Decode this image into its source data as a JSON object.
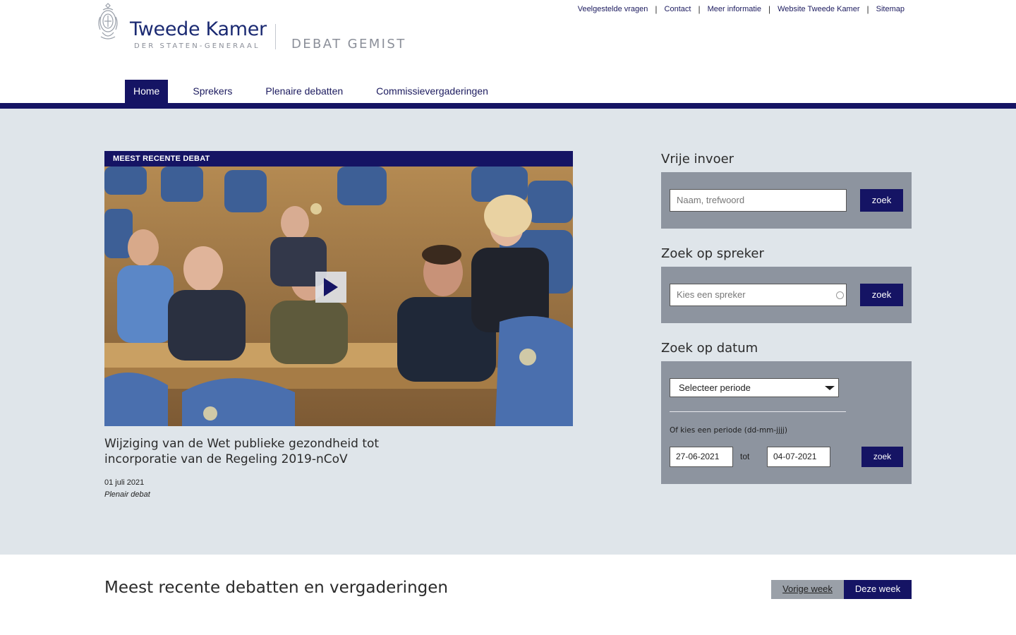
{
  "header": {
    "logo_name": "Tweede Kamer",
    "logo_sub": "DER STATEN-GENERAAL",
    "app_name": "DEBAT GEMIST",
    "top_links": [
      "Veelgestelde vragen",
      "Contact",
      "Meer informatie",
      "Website Tweede Kamer",
      "Sitemap"
    ],
    "top_link_separator": "|"
  },
  "nav": {
    "items": [
      "Home",
      "Sprekers",
      "Plenaire debatten",
      "Commissievergaderingen"
    ],
    "active": "Home"
  },
  "feature": {
    "label": "MEEST RECENTE DEBAT",
    "title": "Wijziging van de Wet publieke gezondheid tot incorporatie van de Regeling 2019-nCoV",
    "date": "01 juli 2021",
    "type": "Plenair debat"
  },
  "search": {
    "free": {
      "heading": "Vrije invoer",
      "placeholder": "Naam, trefwoord",
      "button": "zoek"
    },
    "speaker": {
      "heading": "Zoek op spreker",
      "placeholder": "Kies een spreker",
      "button": "zoek"
    },
    "date": {
      "heading": "Zoek op datum",
      "select_value": "Selecteer periode",
      "hint": "Of kies een periode (dd-mm-jjjj)",
      "from": "27-06-2021",
      "between": "tot",
      "to": "04-07-2021",
      "button": "zoek"
    }
  },
  "recent": {
    "heading": "Meest recente debatten en vergaderingen",
    "tabs": [
      "Vorige week",
      "Deze week"
    ],
    "active_tab": "Deze week"
  },
  "colors": {
    "brand_navy": "#151464",
    "hero_bg": "#dfe5ea",
    "panel_bg": "#8d949f"
  },
  "icons": {
    "crest": "royal-crest-icon",
    "play": "play-icon",
    "select_arrow": "chevron-down-icon"
  }
}
